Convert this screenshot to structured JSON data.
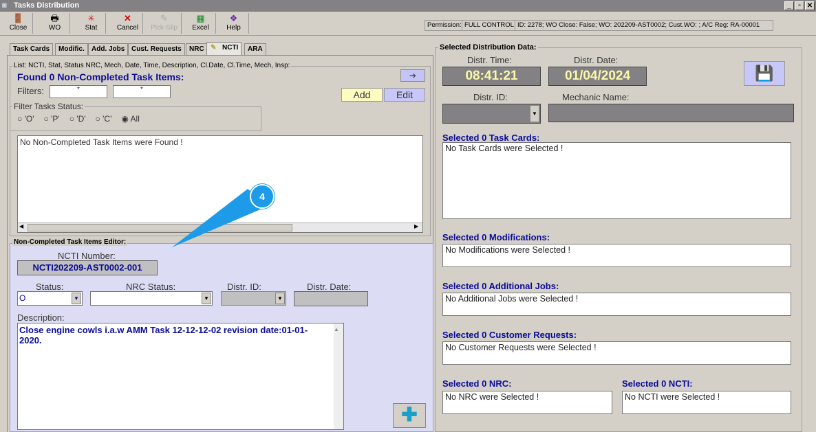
{
  "window": {
    "title": "Tasks Distribution",
    "min": "_",
    "max": "▫",
    "close": "✕"
  },
  "toolbar": [
    {
      "label": "Close",
      "icon": "door-exit-icon",
      "glyph": "🚪"
    },
    {
      "label": "WO",
      "icon": "printer-icon",
      "glyph": "🖶"
    },
    {
      "label": "Stat",
      "icon": "stat-icon",
      "glyph": "✳"
    },
    {
      "label": "Cancel",
      "icon": "cancel-x-icon",
      "glyph": "✕"
    },
    {
      "label": "Pick-Slip",
      "icon": "pick-slip-icon",
      "glyph": "✎"
    },
    {
      "label": "Excel",
      "icon": "excel-icon",
      "glyph": "▦"
    },
    {
      "label": "Help",
      "icon": "help-book-icon",
      "glyph": "❖"
    }
  ],
  "info": {
    "permission_label": "Permission:",
    "permission_value": "FULL CONTROL",
    "details": "ID: 2278; WO Close: False; WO: 202209-AST0002; Cust.WO:  ; A/C Reg: RA-00001"
  },
  "tabs": [
    "Task Cards",
    "Modific.",
    "Add. Jobs",
    "Cust. Requests",
    "NRC",
    "NCTI",
    "ARA"
  ],
  "list": {
    "group_label": "List: NCTI, Stat, Status NRC, Mech, Date, Time, Description, Cl.Date, Cl.Time, Mech, Insp:",
    "found": "Found 0 Non-Completed Task Items:",
    "filters_label": "Filters:",
    "filter1": "*",
    "filter2": "*",
    "add": "Add",
    "edit": "Edit",
    "arrow": "➔",
    "status_group": "Filter Tasks Status:",
    "radios": [
      "'O'",
      "'P'",
      "'D'",
      "'C'",
      "All"
    ],
    "selected_radio": "All",
    "empty": "No Non-Completed Task Items were Found !"
  },
  "callout": {
    "number": "4",
    "color": "#1e9be8"
  },
  "editor": {
    "group_label": "Non-Completed Task Items Editor:",
    "ncti_label": "NCTI Number:",
    "ncti_value": "NCTI202209-AST0002-001",
    "status_label": "Status:",
    "status_value": "O",
    "nrc_label": "NRC Status:",
    "distr_id_label": "Distr. ID:",
    "distr_date_label": "Distr. Date:",
    "desc_label": "Description:",
    "desc_value": "Close engine cowls i.a.w AMM Task 12-12-12-02 revision date:01-01-2020."
  },
  "dist": {
    "group_label": "Selected Distribution Data:",
    "time_label": "Distr. Time:",
    "time_value": "08:41:21",
    "date_label": "Distr. Date:",
    "date_value": "01/04/2024",
    "id_label": "Distr. ID:",
    "mech_label": "Mechanic Name:",
    "task_cards": {
      "title": "Selected 0 Task Cards:",
      "empty": "No Task Cards were Selected !"
    },
    "mods": {
      "title": "Selected 0 Modifications:",
      "empty": "No Modifications were Selected !"
    },
    "jobs": {
      "title": "Selected 0 Additional Jobs:",
      "empty": "No Additional Jobs were Selected !"
    },
    "cust": {
      "title": "Selected 0 Customer Requests:",
      "empty": "No Customer Requests were Selected !"
    },
    "nrc": {
      "title": "Selected 0 NRC:",
      "empty": "No NRC were Selected !"
    },
    "ncti": {
      "title": "Selected 0 NCTI:",
      "empty": "No NCTI were Selected !"
    }
  }
}
